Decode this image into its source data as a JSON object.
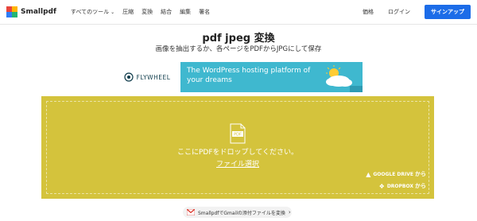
{
  "header": {
    "brand": "Smallpdf",
    "nav": [
      {
        "label": "すべてのツール",
        "dropdown": true
      },
      {
        "label": "圧縮"
      },
      {
        "label": "変換"
      },
      {
        "label": "結合"
      },
      {
        "label": "編集"
      },
      {
        "label": "署名"
      }
    ],
    "pricing": "価格",
    "login": "ログイン",
    "signup": "サインアップ"
  },
  "main": {
    "title": "pdf jpeg 変換",
    "subtitle": "画像を抽出するか、各ページをPDFからJPGにして保存"
  },
  "banner": {
    "brand": "FLYWHEEL",
    "headline": "The WordPress hosting platform of your dreams"
  },
  "dropzone": {
    "file_label": "PDF",
    "prompt": "ここにPDFをドロップしてください。",
    "choose_file": "ファイル選択",
    "google_drive": "GOOGLE DRIVE",
    "dropbox": "DROPBOX",
    "from_suffix": "から"
  },
  "gmail_chip": {
    "label": "SmallpdfでGmailの添付ファイルを変換"
  },
  "colors": {
    "accent": "#1c6ce8",
    "dropzone": "#d4c33c",
    "banner": "#3fb8cf"
  }
}
